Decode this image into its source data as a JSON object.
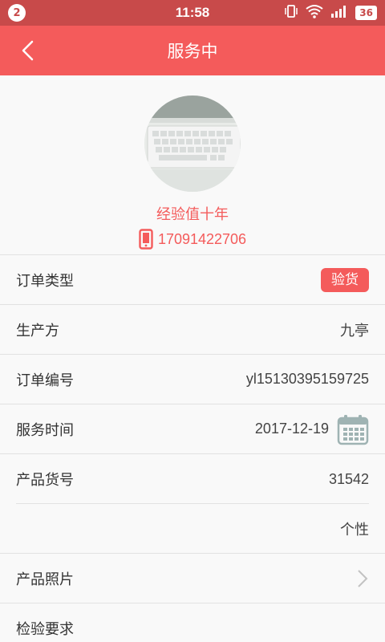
{
  "status_bar": {
    "notification_count": "2",
    "time": "11:58",
    "battery": "36",
    "icons": [
      "vibrate-icon",
      "wifi-icon",
      "signal-icon"
    ]
  },
  "nav": {
    "title": "服务中",
    "back_icon": "chevron-left-icon"
  },
  "profile": {
    "name": "经验值十年",
    "phone": "17091422706",
    "phone_icon": "phone-icon"
  },
  "rows": {
    "order_type": {
      "label": "订单类型",
      "value": "验货"
    },
    "producer": {
      "label": "生产方",
      "value": "九亭"
    },
    "order_no": {
      "label": "订单编号",
      "value": "yl15130395159725"
    },
    "service_time": {
      "label": "服务时间",
      "value": "2017-12-19",
      "icon": "calendar-icon"
    },
    "product_no": {
      "label": "产品货号",
      "value": "31542"
    },
    "product_extra": {
      "value": "个性"
    },
    "product_photo": {
      "label": "产品照片",
      "icon": "chevron-right-icon"
    },
    "inspection": {
      "label": "检验要求"
    }
  },
  "colors": {
    "accent": "#f45b5b",
    "status_bar": "#c84a4a"
  }
}
